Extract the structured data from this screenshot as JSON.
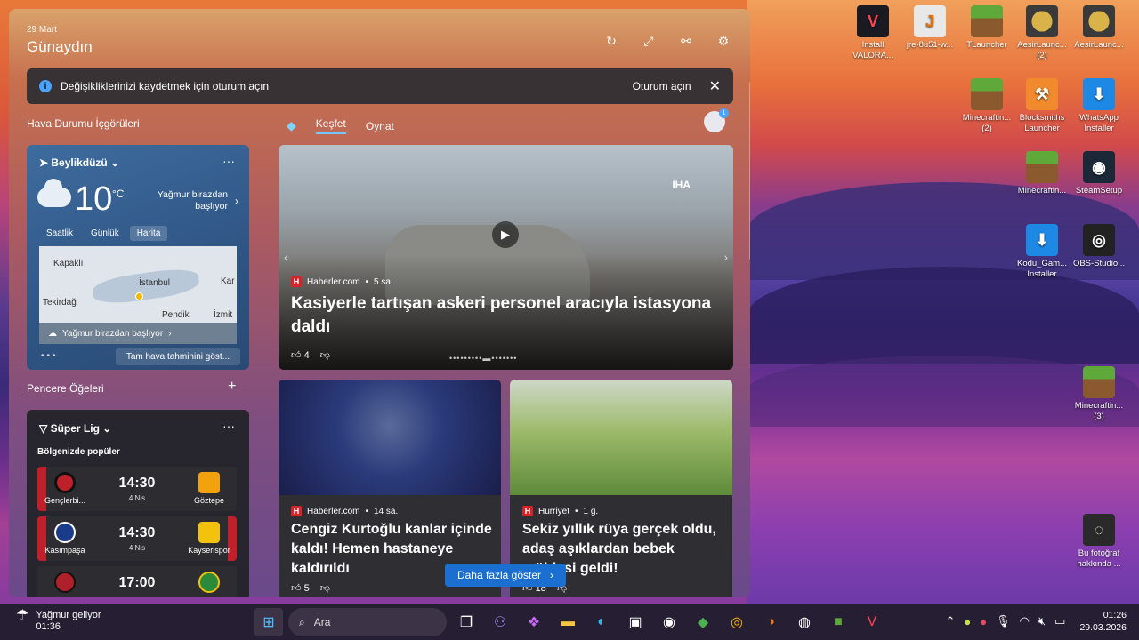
{
  "panel": {
    "date": "29 Mart",
    "greeting": "Günaydın"
  },
  "signin_banner": {
    "message": "Değişikliklerinizi kaydetmek için oturum açın",
    "button": "Oturum açın"
  },
  "sections": {
    "weather_title": "Hava Durumu İçgörüleri",
    "widgets_title": "Pencere Öğeleri"
  },
  "weather": {
    "location": "Beylikdüzü",
    "temp": "10",
    "unit": "°C",
    "condition": "Yağmur birazdan başlıyor",
    "tabs": [
      "Saatlik",
      "Günlük",
      "Harita"
    ],
    "map_labels": [
      "Kapaklı",
      "İstanbul",
      "Tekirdağ",
      "Pendik",
      "Kar",
      "İzmit"
    ],
    "map_bar": "Yağmur birazdan başlıyor",
    "full_forecast": "Tam hava tahminini göst..."
  },
  "league": {
    "title": "Süper Lig",
    "subtitle": "Bölgenizde popüler",
    "matches": [
      {
        "home": "Gençlerbi...",
        "away": "Göztepe",
        "time": "14:30",
        "day": "4 Nis"
      },
      {
        "home": "Kasımpaşa",
        "away": "Kayserispor",
        "time": "14:30",
        "day": "4 Nis"
      },
      {
        "home": "",
        "away": "",
        "time": "17:00",
        "day": ""
      }
    ]
  },
  "feed": {
    "tabs": [
      "Keşfet",
      "Oynat"
    ],
    "avatar_badge": "1",
    "hero": {
      "source": "Haberler.com",
      "age": "5 sa.",
      "watermark": "İHA",
      "headline": "Kasiyerle tartışan askeri personel aracıyla istasyona daldı",
      "likes": "4"
    },
    "cards": [
      {
        "source": "Haberler.com",
        "age": "14 sa.",
        "headline": "Cengiz Kurtoğlu kanlar içinde kaldı! Hemen hastaneye kaldırıldı",
        "likes": "5"
      },
      {
        "source": "Hürriyet",
        "age": "1 g.",
        "headline": "Sekiz yıllık rüya gerçek oldu, adaş aşıklardan bebek müjdesi geldi!",
        "likes": "18"
      }
    ],
    "more_button": "Daha fazla göster"
  },
  "desktop_icons": [
    {
      "label": "Install VALORA...",
      "glyph": "V"
    },
    {
      "label": "jre-8u51-w...",
      "glyph": "J"
    },
    {
      "label": "TLauncher",
      "glyph": ""
    },
    {
      "label": "AesirLaunc... (2)",
      "glyph": ""
    },
    {
      "label": "AesirLaunc...",
      "glyph": ""
    },
    {
      "label": "Minecraftin... (2)",
      "glyph": ""
    },
    {
      "label": "Blocksmiths Launcher",
      "glyph": "⚒"
    },
    {
      "label": "WhatsApp Installer",
      "glyph": "⬇"
    },
    {
      "label": "Minecraftin...",
      "glyph": ""
    },
    {
      "label": "SteamSetup",
      "glyph": "◉"
    },
    {
      "label": "Kodu_Gam... Installer",
      "glyph": "⬇"
    },
    {
      "label": "OBS-Studio...",
      "glyph": "◎"
    },
    {
      "label": "Minecraftin... (3)",
      "glyph": ""
    },
    {
      "label": "Bu fotoğraf hakkında ...",
      "glyph": "◌"
    }
  ],
  "taskbar": {
    "weather_title": "Yağmur geliyor",
    "weather_time": "01:36",
    "search_placeholder": "Ara",
    "time": "01:26",
    "date": "29.03.2026"
  }
}
